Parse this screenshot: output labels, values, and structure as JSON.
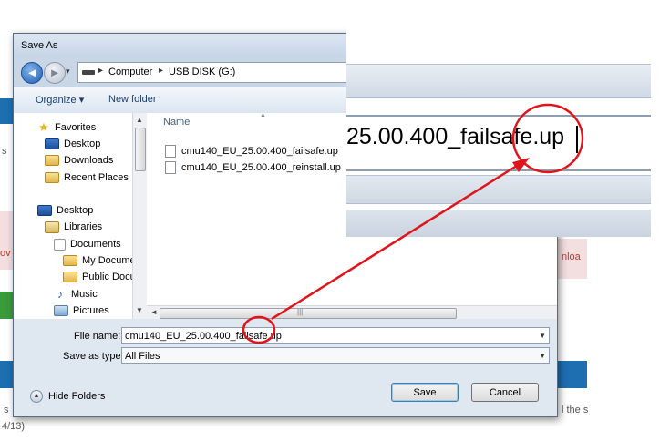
{
  "background_page": {
    "left_fragment_text": "ov",
    "right_fragment_text": "nloa",
    "left_s_1": "s",
    "left_s_2": "s",
    "date_fragment": "4/13)",
    "right_tail_text": "l the s"
  },
  "dialog": {
    "title": "Save As",
    "address": {
      "parts": [
        "Computer",
        "USB DISK (G:)"
      ]
    },
    "toolbar": {
      "organize_label": "Organize ▾",
      "new_folder_label": "New folder"
    },
    "nav_tree": [
      {
        "label": "Favorites",
        "icon": "star-icon"
      },
      {
        "label": "Desktop",
        "icon": "desktop-icon"
      },
      {
        "label": "Downloads",
        "icon": "downloads-folder-icon"
      },
      {
        "label": "Recent Places",
        "icon": "recent-places-icon"
      },
      {
        "label": "Desktop",
        "icon": "desktop-icon"
      },
      {
        "label": "Libraries",
        "icon": "library-icon"
      },
      {
        "label": "Documents",
        "icon": "documents-icon"
      },
      {
        "label": "My Documer",
        "icon": "folder-icon"
      },
      {
        "label": "Public Docur",
        "icon": "folder-icon"
      },
      {
        "label": "Music",
        "icon": "music-icon"
      },
      {
        "label": "Pictures",
        "icon": "pictures-icon"
      }
    ],
    "file_list": {
      "column_header": "Name",
      "files": [
        "cmu140_EU_25.00.400_failsafe.up",
        "cmu140_EU_25.00.400_reinstall.up"
      ]
    },
    "file_name_label": "File name:",
    "file_name_value": "cmu140_EU_25.00.400_failsafe.up",
    "save_as_type_label": "Save as type:",
    "save_as_type_value": "All Files",
    "hide_folders_label": "Hide Folders",
    "save_label": "Save",
    "cancel_label": "Cancel"
  },
  "zoom_callout": {
    "text": "25.00.400_failsafe.up"
  },
  "colors": {
    "annotation_red": "#e0141b",
    "dialog_frame": "#c9d6e6"
  }
}
